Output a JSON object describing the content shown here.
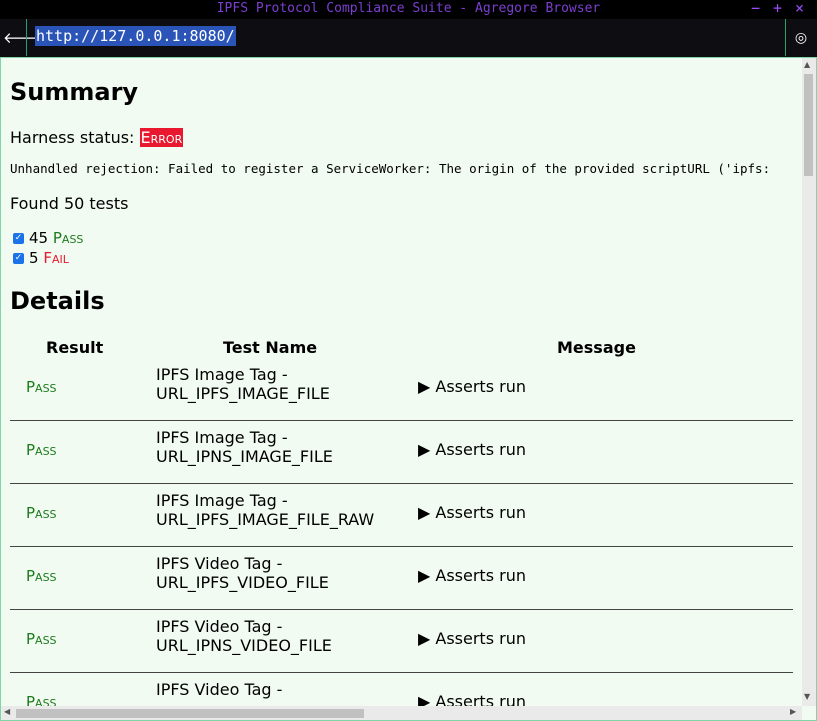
{
  "window": {
    "title": "IPFS Protocol Compliance Suite - Agregore Browser",
    "controls": {
      "minimize": "−",
      "maximize": "+",
      "close": "×"
    }
  },
  "toolbar": {
    "back": "🡐",
    "url": "http://127.0.0.1:8080/",
    "settings": "◎"
  },
  "page": {
    "summary_heading": "Summary",
    "harness_label": "Harness status:",
    "harness_status": "Error",
    "rejection_text": "Unhandled rejection: Failed to register a ServiceWorker: The origin of the provided scriptURL ('ipfs:",
    "found_text": "Found 50 tests",
    "filters": [
      {
        "count": "45",
        "label": "Pass",
        "checked": true
      },
      {
        "count": "5",
        "label": "Fail",
        "checked": true
      }
    ],
    "details_heading": "Details",
    "columns": {
      "result": "Result",
      "test_name": "Test Name",
      "message": "Message"
    },
    "rows": [
      {
        "result": "Pass",
        "name1": "IPFS Image Tag -",
        "name2": "URL_IPFS_IMAGE_FILE",
        "message": "Asserts run"
      },
      {
        "result": "Pass",
        "name1": "IPFS Image Tag -",
        "name2": "URL_IPNS_IMAGE_FILE",
        "message": "Asserts run"
      },
      {
        "result": "Pass",
        "name1": "IPFS Image Tag -",
        "name2": "URL_IPFS_IMAGE_FILE_RAW",
        "message": "Asserts run"
      },
      {
        "result": "Pass",
        "name1": "IPFS Video Tag -",
        "name2": "URL_IPFS_VIDEO_FILE",
        "message": "Asserts run"
      },
      {
        "result": "Pass",
        "name1": "IPFS Video Tag -",
        "name2": "URL_IPNS_VIDEO_FILE",
        "message": "Asserts run"
      },
      {
        "result": "Pass",
        "name1": "IPFS Video Tag -",
        "name2": "",
        "message": "Asserts run"
      }
    ]
  }
}
